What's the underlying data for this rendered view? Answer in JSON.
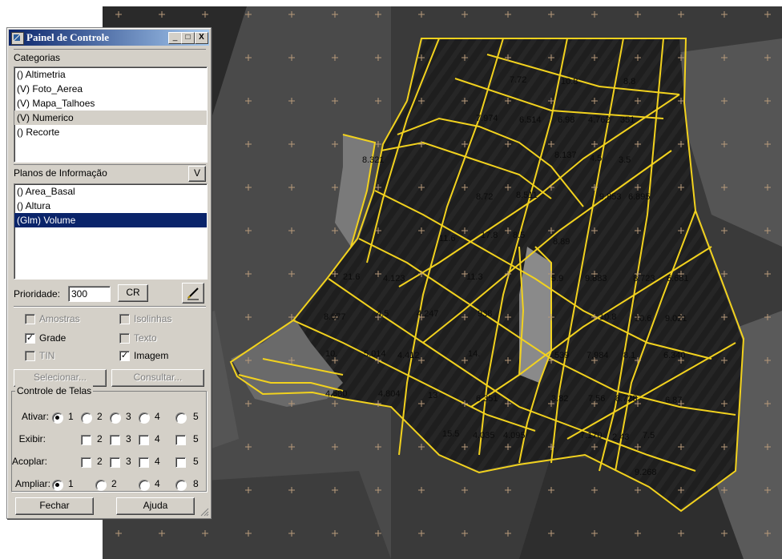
{
  "window": {
    "title": "Painel de Controle",
    "minimize": "_",
    "maximize": "□",
    "close": "X"
  },
  "categorias": {
    "label": "Categorias",
    "items": [
      "() Altimetria",
      "(V) Foto_Aerea",
      "(V) Mapa_Talhoes",
      "(V) Numerico",
      "() Recorte"
    ],
    "selected_index": 3
  },
  "planos": {
    "label": "Planos de Informação",
    "v_button": "V",
    "items": [
      "() Area_Basal",
      "() Altura",
      "(Glm) Volume"
    ],
    "selected_index": 2
  },
  "prioridade": {
    "label": "Prioridade:",
    "value": "300",
    "cr_button": "CR",
    "color_icon": "pencil-color-icon"
  },
  "options": {
    "amostras": {
      "label": "Amostras",
      "checked": false,
      "enabled": false
    },
    "isolinhas": {
      "label": "Isolinhas",
      "checked": false,
      "enabled": false
    },
    "grade": {
      "label": "Grade",
      "checked": true,
      "enabled": true
    },
    "texto": {
      "label": "Texto",
      "checked": false,
      "enabled": false
    },
    "tin": {
      "label": "TIN",
      "checked": false,
      "enabled": false
    },
    "imagem": {
      "label": "Imagem",
      "checked": true,
      "enabled": true
    }
  },
  "actions": {
    "selecionar": "Selecionar...",
    "consultar": "Consultar..."
  },
  "telas": {
    "group_label": "Controle de Telas",
    "ativar_label": "Ativar:",
    "exibir_label": "Exibir:",
    "acoplar_label": "Acoplar:",
    "ampliar_label": "Ampliar:",
    "ativar_options": [
      "1",
      "2",
      "3",
      "4",
      "5"
    ],
    "ativar_selected": "1",
    "exibir_options": [
      "2",
      "3",
      "4",
      "5"
    ],
    "acoplar_options": [
      "2",
      "3",
      "4",
      "5"
    ],
    "ampliar_options": [
      "1",
      "2",
      "4",
      "8"
    ],
    "ampliar_selected": "1"
  },
  "bottom": {
    "fechar": "Fechar",
    "ajuda": "Ajuda"
  },
  "map": {
    "boundary_color": "#f2d21e",
    "grid_marker_color": "#b89a7a",
    "labels": [
      "7.72",
      "10.8",
      "8.8",
      "7.974",
      "6.514",
      "6.98",
      "4.762",
      "351",
      "8.321",
      "8.137",
      "4.5",
      "3.5",
      "8.72",
      "8.511",
      "9.853",
      "6.895",
      "11.6",
      "17.8",
      "8.5",
      "8.89",
      "21.6",
      "4.123",
      "11.3",
      "5.9",
      "9.883",
      "8.723",
      "6.681",
      "8.077",
      "4.5",
      "4.247",
      "938",
      "10.8",
      "10.6",
      "9.021",
      "10.",
      "5.014",
      "4.412",
      "14.",
      "539",
      "7.984",
      "8.1",
      "6.340",
      "4.580",
      "4.804",
      "13",
      "6.351",
      "3.82",
      "7.56",
      "8.728",
      "6.87",
      "15.5",
      "4.035",
      "4.095",
      "7.170",
      "2.43",
      "7.5",
      "9.268"
    ]
  }
}
